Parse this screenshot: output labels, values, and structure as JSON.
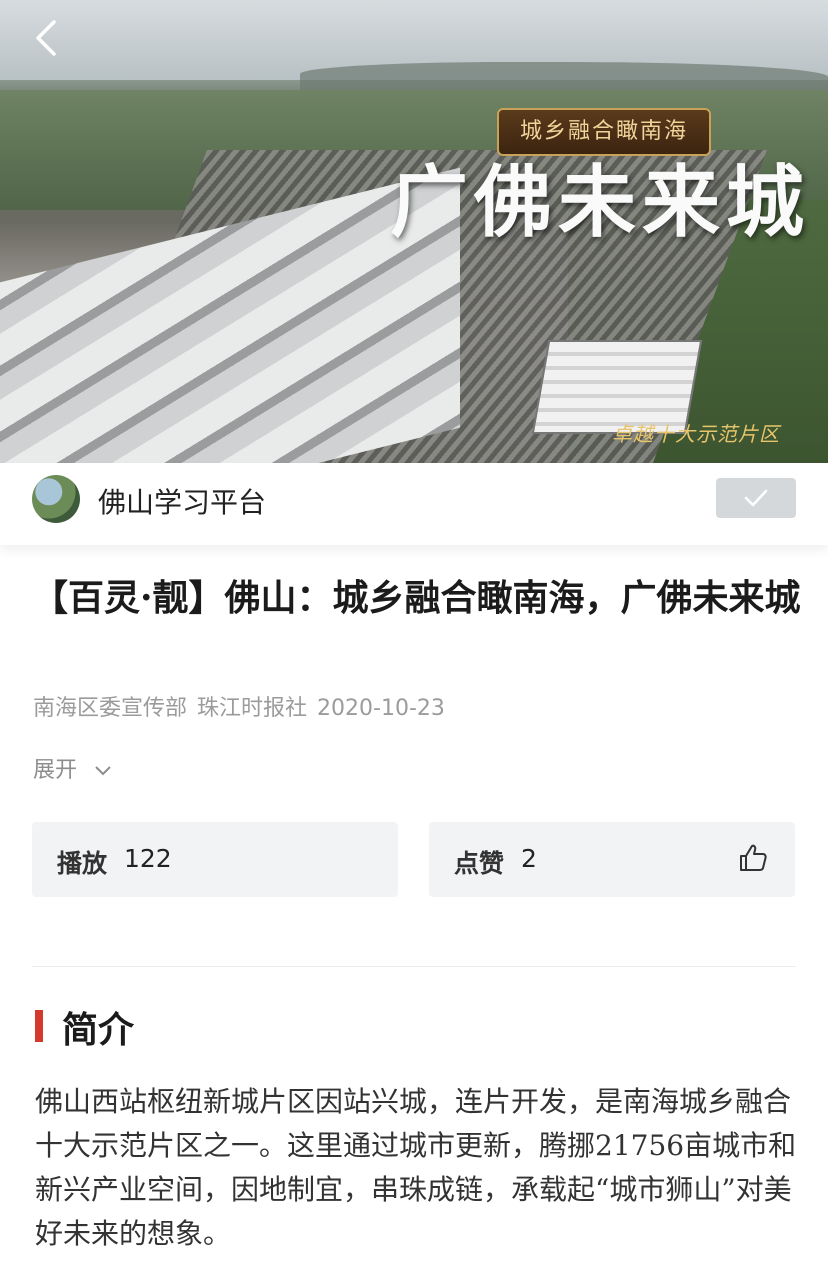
{
  "video": {
    "badge_text": "城乡融合瞰南海",
    "calligraphy_title": "广佛未来城",
    "caption": "卓越十大示范片区"
  },
  "account": {
    "name": "佛山学习平台",
    "follow_state_icon": "check-icon"
  },
  "article": {
    "title": "【百灵·靓】佛山：城乡融合瞰南海，广佛未来城",
    "source_1": "南海区委宣传部",
    "source_2": "珠江时报社",
    "date": "2020-10-23",
    "expand_label": "展开"
  },
  "stats": {
    "play_label": "播放",
    "play_count": "122",
    "like_label": "点赞",
    "like_count": "2"
  },
  "intro": {
    "heading": "简介",
    "text": "佛山西站枢纽新城片区因站兴城，连片开发，是南海城乡融合十大示范片区之一。这里通过城市更新，腾挪21756亩城市和新兴产业空间，因地制宜，串珠成链，承载起“城市狮山”对美好未来的想象。"
  },
  "colors": {
    "accent": "#d33a2c",
    "card_bg": "#f2f3f5",
    "follow_bg": "#d5d8db"
  }
}
